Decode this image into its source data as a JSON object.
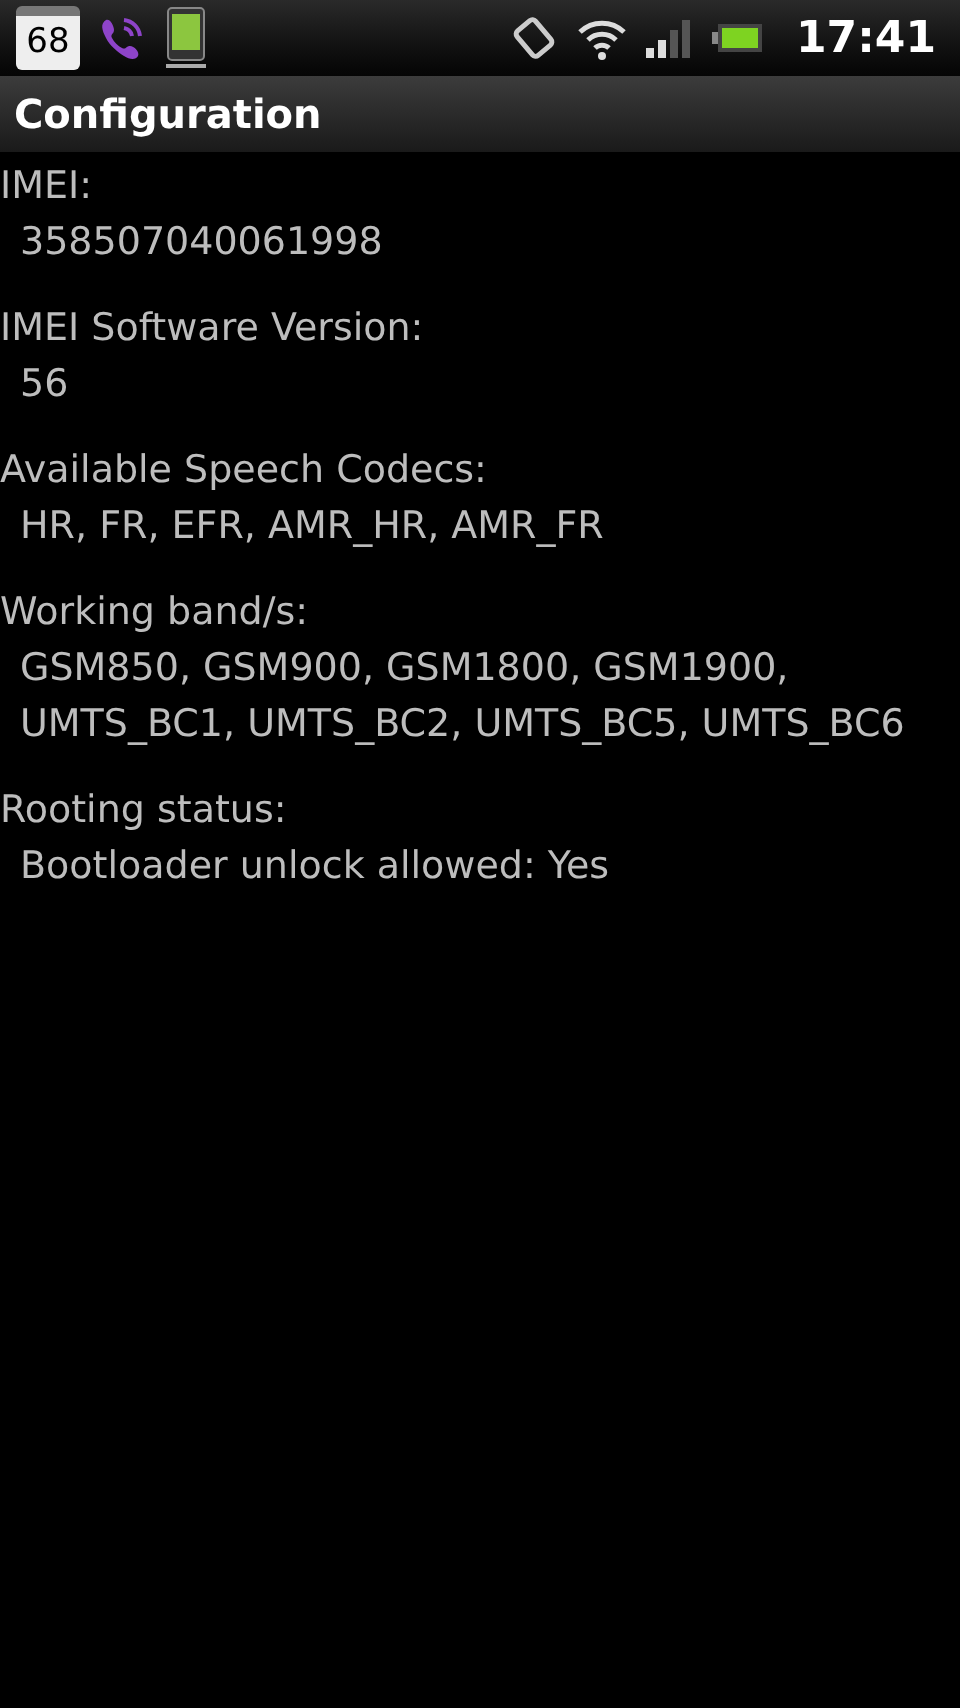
{
  "status_bar": {
    "calendar_day": "68",
    "time": "17:41"
  },
  "title": "Configuration",
  "sections": [
    {
      "label": "IMEI:",
      "lines": [
        "358507040061998"
      ]
    },
    {
      "label": "IMEI Software Version:",
      "lines": [
        "56"
      ]
    },
    {
      "label": "Available Speech Codecs:",
      "lines": [
        "HR, FR, EFR, AMR_HR, AMR_FR"
      ]
    },
    {
      "label": "Working band/s:",
      "lines": [
        "GSM850, GSM900, GSM1800, GSM1900,",
        "UMTS_BC1, UMTS_BC2, UMTS_BC5, UMTS_BC6"
      ]
    },
    {
      "label": "Rooting status:",
      "lines": [
        "Bootloader unlock allowed: Yes"
      ]
    }
  ]
}
